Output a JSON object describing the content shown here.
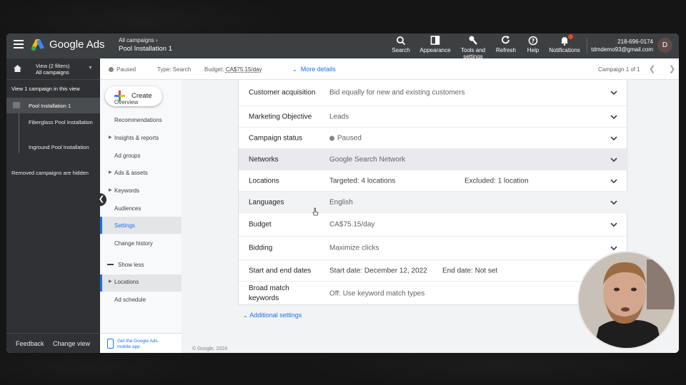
{
  "topbar": {
    "brand": "Google Ads",
    "breadcrumb_top": "All campaigns",
    "breadcrumb_main": "Pool Installation 1",
    "tools": [
      {
        "icon": "search-icon",
        "label": "Search"
      },
      {
        "icon": "appearance-icon",
        "label": "Appearance"
      },
      {
        "icon": "tools-icon",
        "label": "Tools and settings"
      },
      {
        "icon": "refresh-icon",
        "label": "Refresh"
      },
      {
        "icon": "help-icon",
        "label": "Help"
      },
      {
        "icon": "bell-icon",
        "label": "Notifications"
      }
    ],
    "account_phone": "218-696-0174",
    "account_email": "tdmdemo93@gmail.com",
    "avatar_letter": "D",
    "notification_color": "#ea4335"
  },
  "leftnav": {
    "view_line1": "View (2 filters)",
    "view_line2": "All campaigns",
    "view_one": "View 1 campaign in this view",
    "campaign": "Pool Installation 1",
    "adgroups": [
      "Fiberglass Pool Installation",
      "Inground Pool Installation"
    ],
    "removed_note": "Removed campaigns are hidden",
    "feedback": "Feedback",
    "change_view": "Change view"
  },
  "subnav": {
    "create": "Create",
    "items": [
      {
        "label": "Overview",
        "arrow": false
      },
      {
        "label": "Recommendations",
        "arrow": false
      },
      {
        "label": "Insights & reports",
        "arrow": true
      },
      {
        "label": "Ad groups",
        "arrow": false
      },
      {
        "label": "Ads & assets",
        "arrow": true
      },
      {
        "label": "Keywords",
        "arrow": true
      },
      {
        "label": "Audiences",
        "arrow": false
      },
      {
        "label": "Settings",
        "arrow": false,
        "active": true
      },
      {
        "label": "Change history",
        "arrow": false
      }
    ],
    "show_less": "Show less",
    "extra_items": [
      {
        "label": "Locations",
        "arrow": true
      },
      {
        "label": "Ad schedule",
        "arrow": false
      }
    ],
    "mobile_app": "Get the Google Ads mobile app"
  },
  "infobar": {
    "status": "Paused",
    "type": "Type: Search",
    "budget_label": "Budget:",
    "budget_value": "CA$75.15/day",
    "more_details": "More details",
    "campaign_count": "Campaign 1 of 1"
  },
  "settings": {
    "rows": [
      {
        "label": "Customer acquisition",
        "value": "Bid equally for new and existing customers"
      },
      {
        "label": "Marketing Objective",
        "value": "Leads"
      },
      {
        "label": "Campaign status",
        "value": "Paused",
        "status_dot": true
      },
      {
        "label": "Networks",
        "value": "Google Search Network",
        "shaded": true
      },
      {
        "label": "Locations",
        "value_prefix": "Targeted: ",
        "value": "4 locations",
        "value2_prefix": "Excluded: ",
        "value2": "1 location"
      },
      {
        "label": "Languages",
        "value": "English",
        "shaded": true
      },
      {
        "label": "Budget",
        "value": "CA$75.15/day"
      },
      {
        "label": "Bidding",
        "value": "Maximize clicks"
      },
      {
        "label": "Start and end dates",
        "value": "Start date: December 12, 2022",
        "value2": "End date: Not set"
      },
      {
        "label": "Broad match keywords",
        "value": "Off: Use keyword match types"
      }
    ],
    "additional": "Additional settings"
  },
  "footer": {
    "copyright": "© Google, 2024"
  },
  "colors": {
    "accent": "#1a73e8",
    "header": "#3c4043",
    "sidebar": "#303134"
  }
}
